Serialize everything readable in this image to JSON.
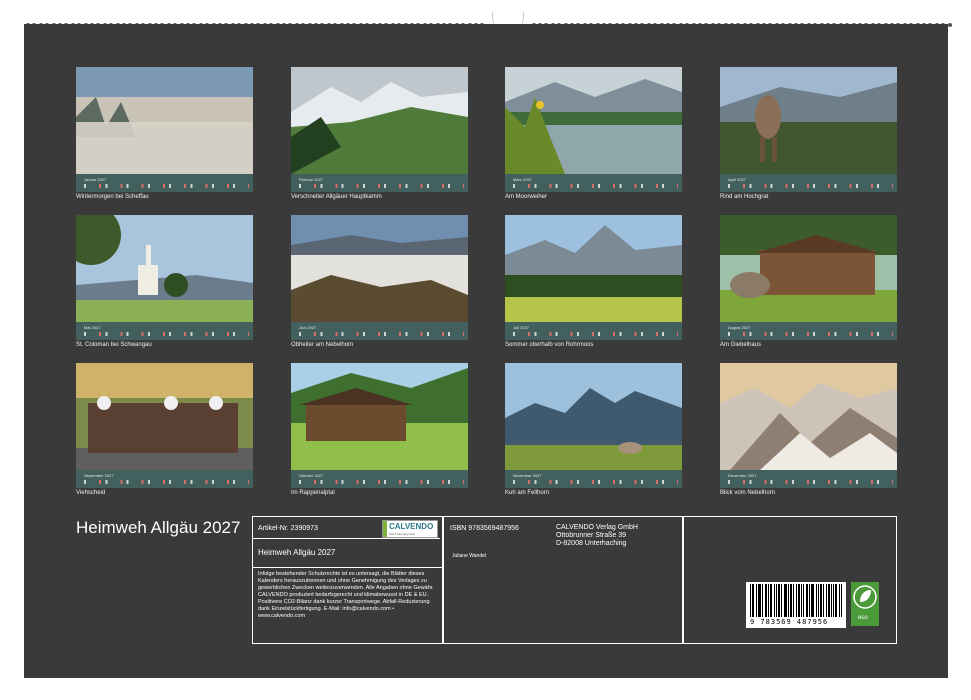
{
  "calendar": {
    "title": "Heimweh Allgäu 2027",
    "months": [
      {
        "label": "Januar 2027",
        "caption": "Wintermorgen bei Scheffau",
        "scene": "fog"
      },
      {
        "label": "Februar 2027",
        "caption": "Verschneiter Allgäuer Hauptkamm",
        "scene": "alps"
      },
      {
        "label": "März 2027",
        "caption": "Am Moorweiher",
        "scene": "lake"
      },
      {
        "label": "April 2027",
        "caption": "Rind am Hochgrat",
        "scene": "cow"
      },
      {
        "label": "Mai 2027",
        "caption": "St. Coloman bei Schwangau",
        "scene": "church"
      },
      {
        "label": "Juni 2027",
        "caption": "Obheiter am Nebelhorn",
        "scene": "clouds"
      },
      {
        "label": "Juli 2027",
        "caption": "Sommer oberhalb von Rohrmoos",
        "scene": "summer"
      },
      {
        "label": "August 2027",
        "caption": "Am Giebelhaus",
        "scene": "house"
      },
      {
        "label": "September 2027",
        "caption": "Viehscheid",
        "scene": "parade"
      },
      {
        "label": "Oktober 2027",
        "caption": "Im Rappenalptal",
        "scene": "hut"
      },
      {
        "label": "November 2027",
        "caption": "Kuh am Fellhorn",
        "scene": "peaks"
      },
      {
        "label": "Dezember 2027",
        "caption": "Blick vom Nebelhorn",
        "scene": "snow"
      }
    ]
  },
  "info": {
    "article": "Artikel-Nr. 2390973",
    "product_title": "Heimweh Allgäu 2027",
    "legal_text": "Infolge bestehender Schutzrechte ist es untersagt, die Blätter dieses Kalenders herauszutrennen und ohne Genehmigung des Verlages zu gewerblichen Zwecken weiterzuverwenden. Alle Angaben ohne Gewähr. CALVENDO produziert bedarfsgerecht und klimabewusst in DE & EU. Positivere CO2-Bilanz dank kurzer Transportwege. Abfall-Reduzierung dank Einzelstückfertigung. E-Mail: info@calvendo.com • www.calvendo.com",
    "isbn": "ISBN 9783569487956",
    "author": "Juliane Wandel",
    "publisher_name": "CALVENDO Verlag GmbH",
    "publisher_street": "Ottobrunner Straße 39",
    "publisher_city": "D-82008 Unterhaching",
    "logo_name": "CALVENDO",
    "logo_sub": "Das Kalenderportal",
    "barcode_digits": "9 783569 487956",
    "eco_label": "eco"
  }
}
